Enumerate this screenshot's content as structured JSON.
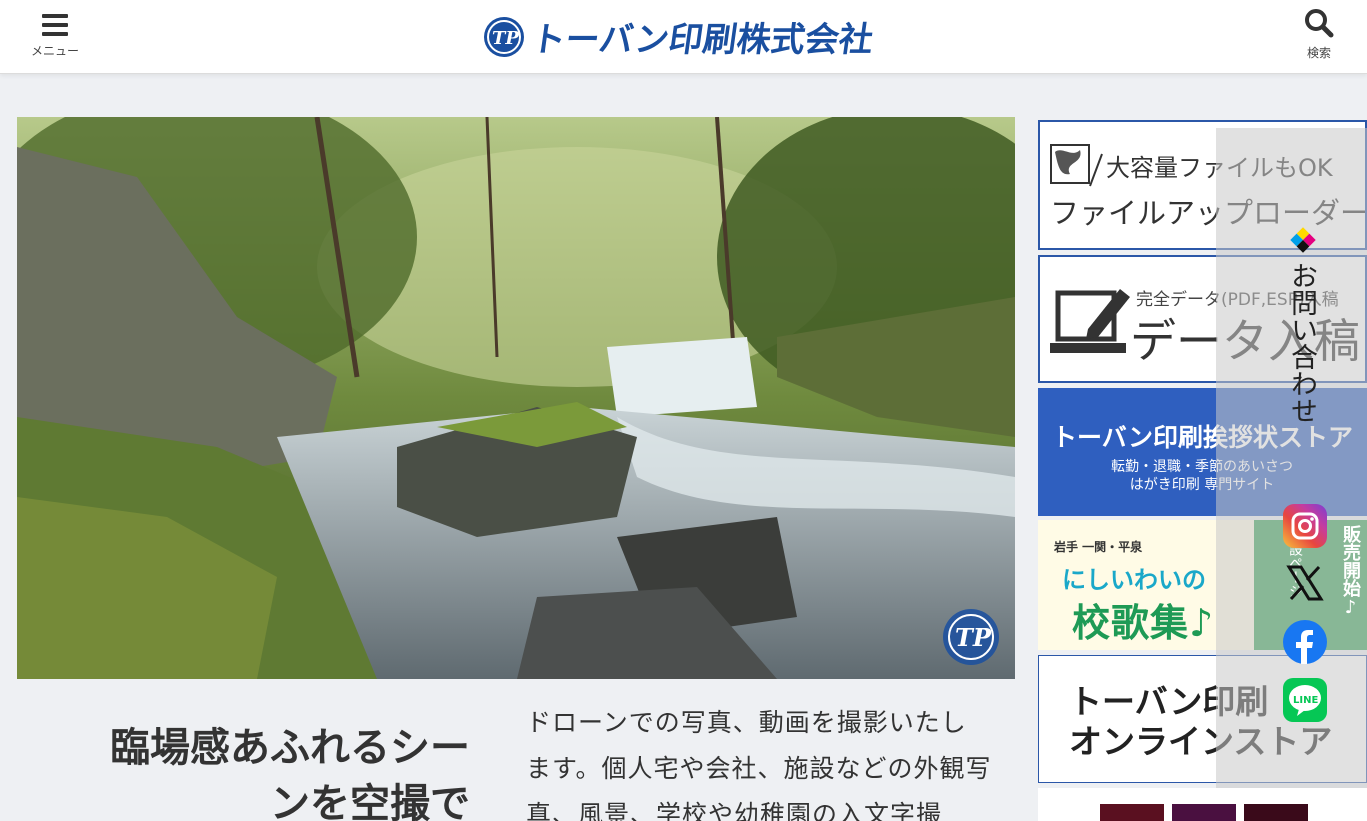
{
  "header": {
    "menu_label": "メニュー",
    "search_label": "検索",
    "logo_text": "トーバン印刷株式会社"
  },
  "hero": {
    "tagline": "臨場感あふれるシーンを空撮で",
    "tagline_line1": "臨場感あふれるシー",
    "tagline_line2": "ンを空撮で",
    "description_line1": "ドローンでの写真、動画を撮影いたし",
    "description_line2": "ます。個人宅や会社、施設などの外観写",
    "description_line3": "真、風景、学校や幼稚園の入文字撮"
  },
  "sidebar": {
    "uploader": {
      "top": "大容量ファイルもOK",
      "main": "ファイルアップローダー"
    },
    "data_submit": {
      "top": "完全データ(PDF,ESP)入稿",
      "main": "データ入稿"
    },
    "greeting_store": {
      "main": "トーバン印刷挨拶状ストア",
      "sub1": "転勤・退職・季節のあいさつ",
      "sub2": "はがき印刷 専門サイト"
    },
    "school_song": {
      "area": "岩手 一関・平泉",
      "sub": "にしいわいの",
      "main": "校歌集♪",
      "badge": "販売開始♪",
      "badge_sub": "特設ページ"
    },
    "online_store": {
      "line1": "トーバン印刷",
      "line2": "オンラインストア"
    }
  },
  "floating": {
    "contact": "お問い合わせ",
    "sns": [
      {
        "name": "instagram",
        "icon": "instagram-icon"
      },
      {
        "name": "x",
        "icon": "x-icon"
      },
      {
        "name": "facebook",
        "icon": "facebook-icon"
      },
      {
        "name": "line",
        "icon": "line-icon",
        "label": "LINE"
      }
    ]
  },
  "colors": {
    "brand": "#1a4fa0",
    "banner_blue": "#2f5fbf",
    "green": "#3aa35a"
  }
}
